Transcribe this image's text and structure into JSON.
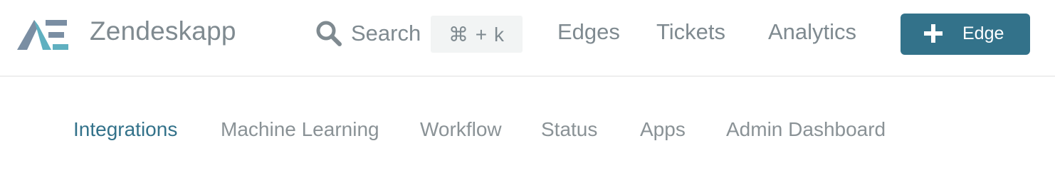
{
  "header": {
    "brand": "Zendeskapp",
    "logo_icon": "ae-logo-icon",
    "search": {
      "label": "Search",
      "icon": "search-icon",
      "shortcut": "⌘ + k"
    },
    "nav": [
      {
        "label": "Edges"
      },
      {
        "label": "Tickets"
      },
      {
        "label": "Analytics"
      }
    ],
    "cta": {
      "label": "Edge",
      "icon": "plus-icon"
    }
  },
  "tabs": [
    {
      "label": "Integrations",
      "active": true
    },
    {
      "label": "Machine Learning",
      "active": false
    },
    {
      "label": "Workflow",
      "active": false
    },
    {
      "label": "Status",
      "active": false
    },
    {
      "label": "Apps",
      "active": false
    },
    {
      "label": "Admin Dashboard",
      "active": false
    }
  ],
  "colors": {
    "accent": "#33728a",
    "text_muted": "#7f8a90",
    "logo_teal": "#5fb0c0",
    "logo_slate": "#7a8ea3"
  }
}
